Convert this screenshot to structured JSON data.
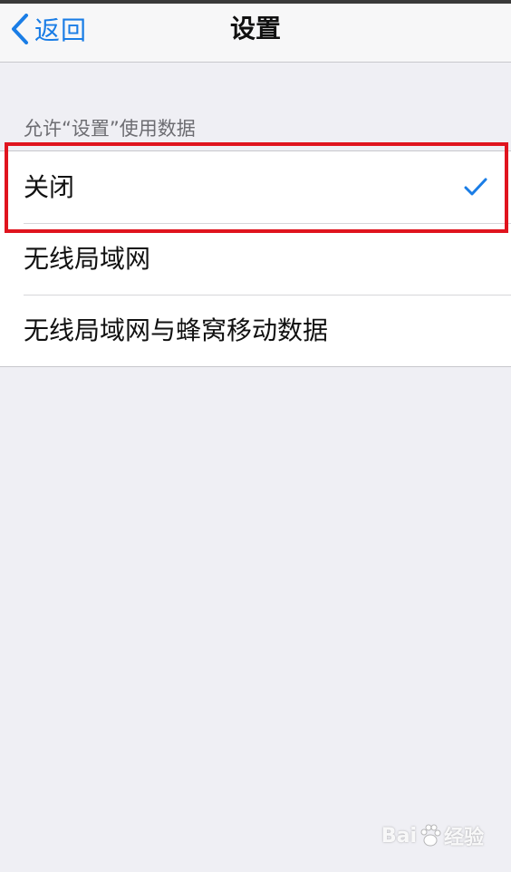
{
  "nav": {
    "back_label": "返回",
    "title": "设置"
  },
  "section": {
    "header": "允许“设置”使用数据"
  },
  "options": [
    {
      "label": "关闭",
      "selected": true
    },
    {
      "label": "无线局域网",
      "selected": false
    },
    {
      "label": "无线局域网与蜂窝移动数据",
      "selected": false
    }
  ],
  "watermark": {
    "text_left": "Bai",
    "text_right": "经验"
  },
  "colors": {
    "accent": "#1a7de6",
    "highlight": "#e0141e",
    "background": "#efeff4"
  },
  "icons": {
    "back": "chevron-left-icon",
    "selected": "checkmark-icon"
  }
}
